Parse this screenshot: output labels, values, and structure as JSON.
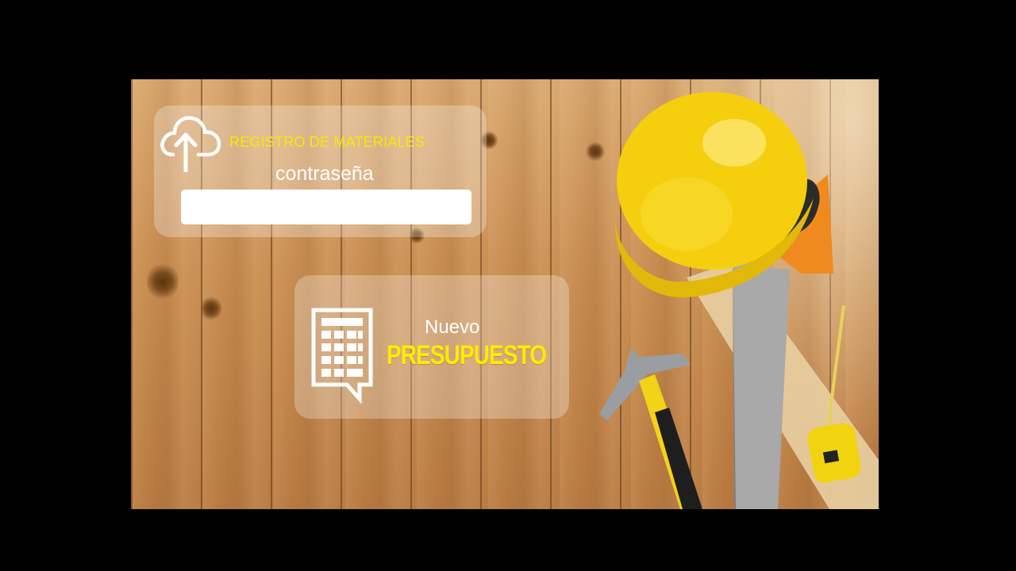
{
  "login": {
    "title": "REGISTRO DE MATERIALES",
    "password_label": "contraseña",
    "password_value": "",
    "icon": "cloud-upload-icon"
  },
  "budget": {
    "line1": "Nuevo",
    "line2": "PRESUPUESTO",
    "icon": "calculator-icon"
  },
  "colors": {
    "accent_yellow": "#ffe600",
    "background": "#000000"
  }
}
